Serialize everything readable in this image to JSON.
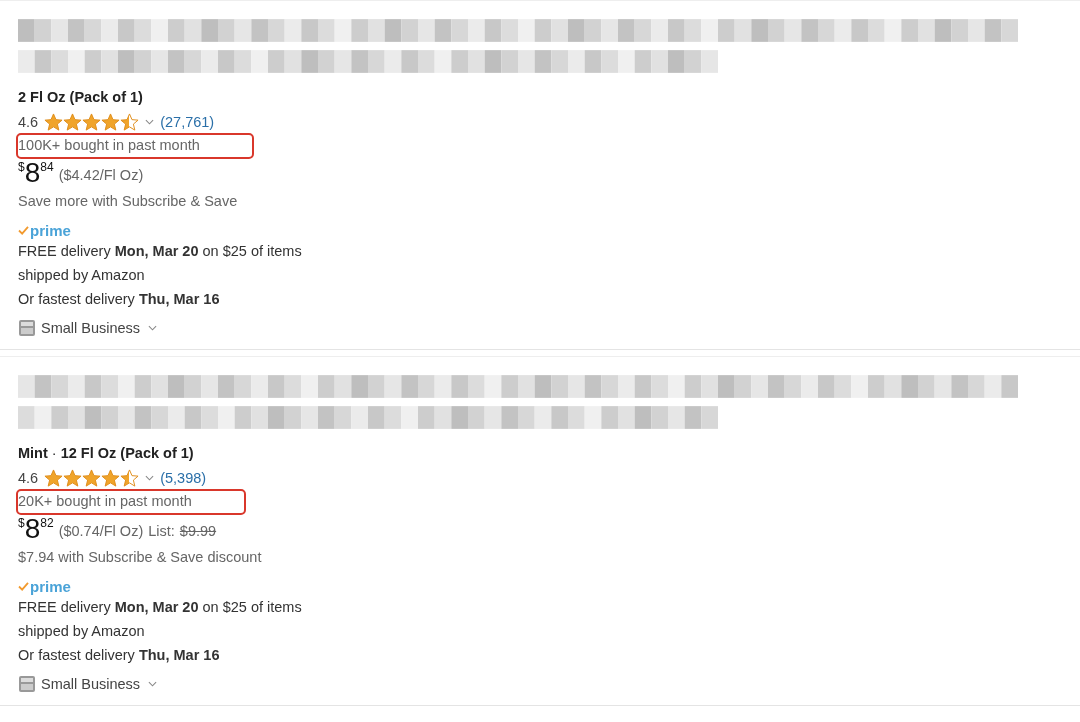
{
  "products": [
    {
      "title": {
        "kind": "pixelated"
      },
      "variant": "**2 Fl Oz (Pack of 1)**",
      "rating": "4.6",
      "stars": 4.5,
      "reviews": "(27,761)",
      "bought": {
        "text": "100K+ bought in past month",
        "highlighted": true
      },
      "price": {
        "currency": "$",
        "whole": "8",
        "fraction": "84"
      },
      "unit_price": "($4.42/Fl Oz)",
      "subscribe": "Save more with Subscribe & Save",
      "prime": "prime",
      "delivery_lines": [
        "FREE delivery **Mon, Mar 20** on $25 of items",
        "shipped by Amazon",
        "Or fastest delivery **Thu, Mar 16**"
      ],
      "badge": "Small Business"
    },
    {
      "title": {
        "kind": "pixelated"
      },
      "variant": "**Mint** · **12 Fl Oz (Pack of 1)**",
      "rating": "4.6",
      "stars": 4.5,
      "reviews": "(5,398)",
      "bought": {
        "text": "20K+ bought in past month",
        "highlighted": true
      },
      "price": {
        "currency": "$",
        "whole": "8",
        "fraction": "82"
      },
      "unit_price": "($0.74/Fl Oz)",
      "list_label": "List:",
      "list_price": "$9.99",
      "subscribe": "$7.94 with Subscribe & Save discount",
      "prime": "prime",
      "delivery_lines": [
        "FREE delivery **Mon, Mar 20** on $25 of items",
        "shipped by Amazon",
        "Or fastest delivery **Thu, Mar 16**"
      ],
      "badge": "Small Business"
    }
  ]
}
